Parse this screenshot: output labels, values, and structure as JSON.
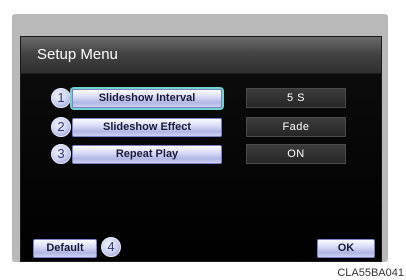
{
  "setup_menu": {
    "title": "Setup Menu",
    "items": [
      {
        "number": "1",
        "label": "Slideshow Interval",
        "value": "5  S"
      },
      {
        "number": "2",
        "label": "Slideshow Effect",
        "value": "Fade"
      },
      {
        "number": "3",
        "label": "Repeat Play",
        "value": "ON"
      }
    ],
    "default_label": "Default",
    "default_number": "4",
    "ok_label": "OK"
  },
  "caption": "CLA55BA041",
  "colors": {
    "button_top": "#fbfcff",
    "button_bottom": "#b1b5e3",
    "highlight": "#6fd4d0",
    "badge_text": "#333a78"
  }
}
